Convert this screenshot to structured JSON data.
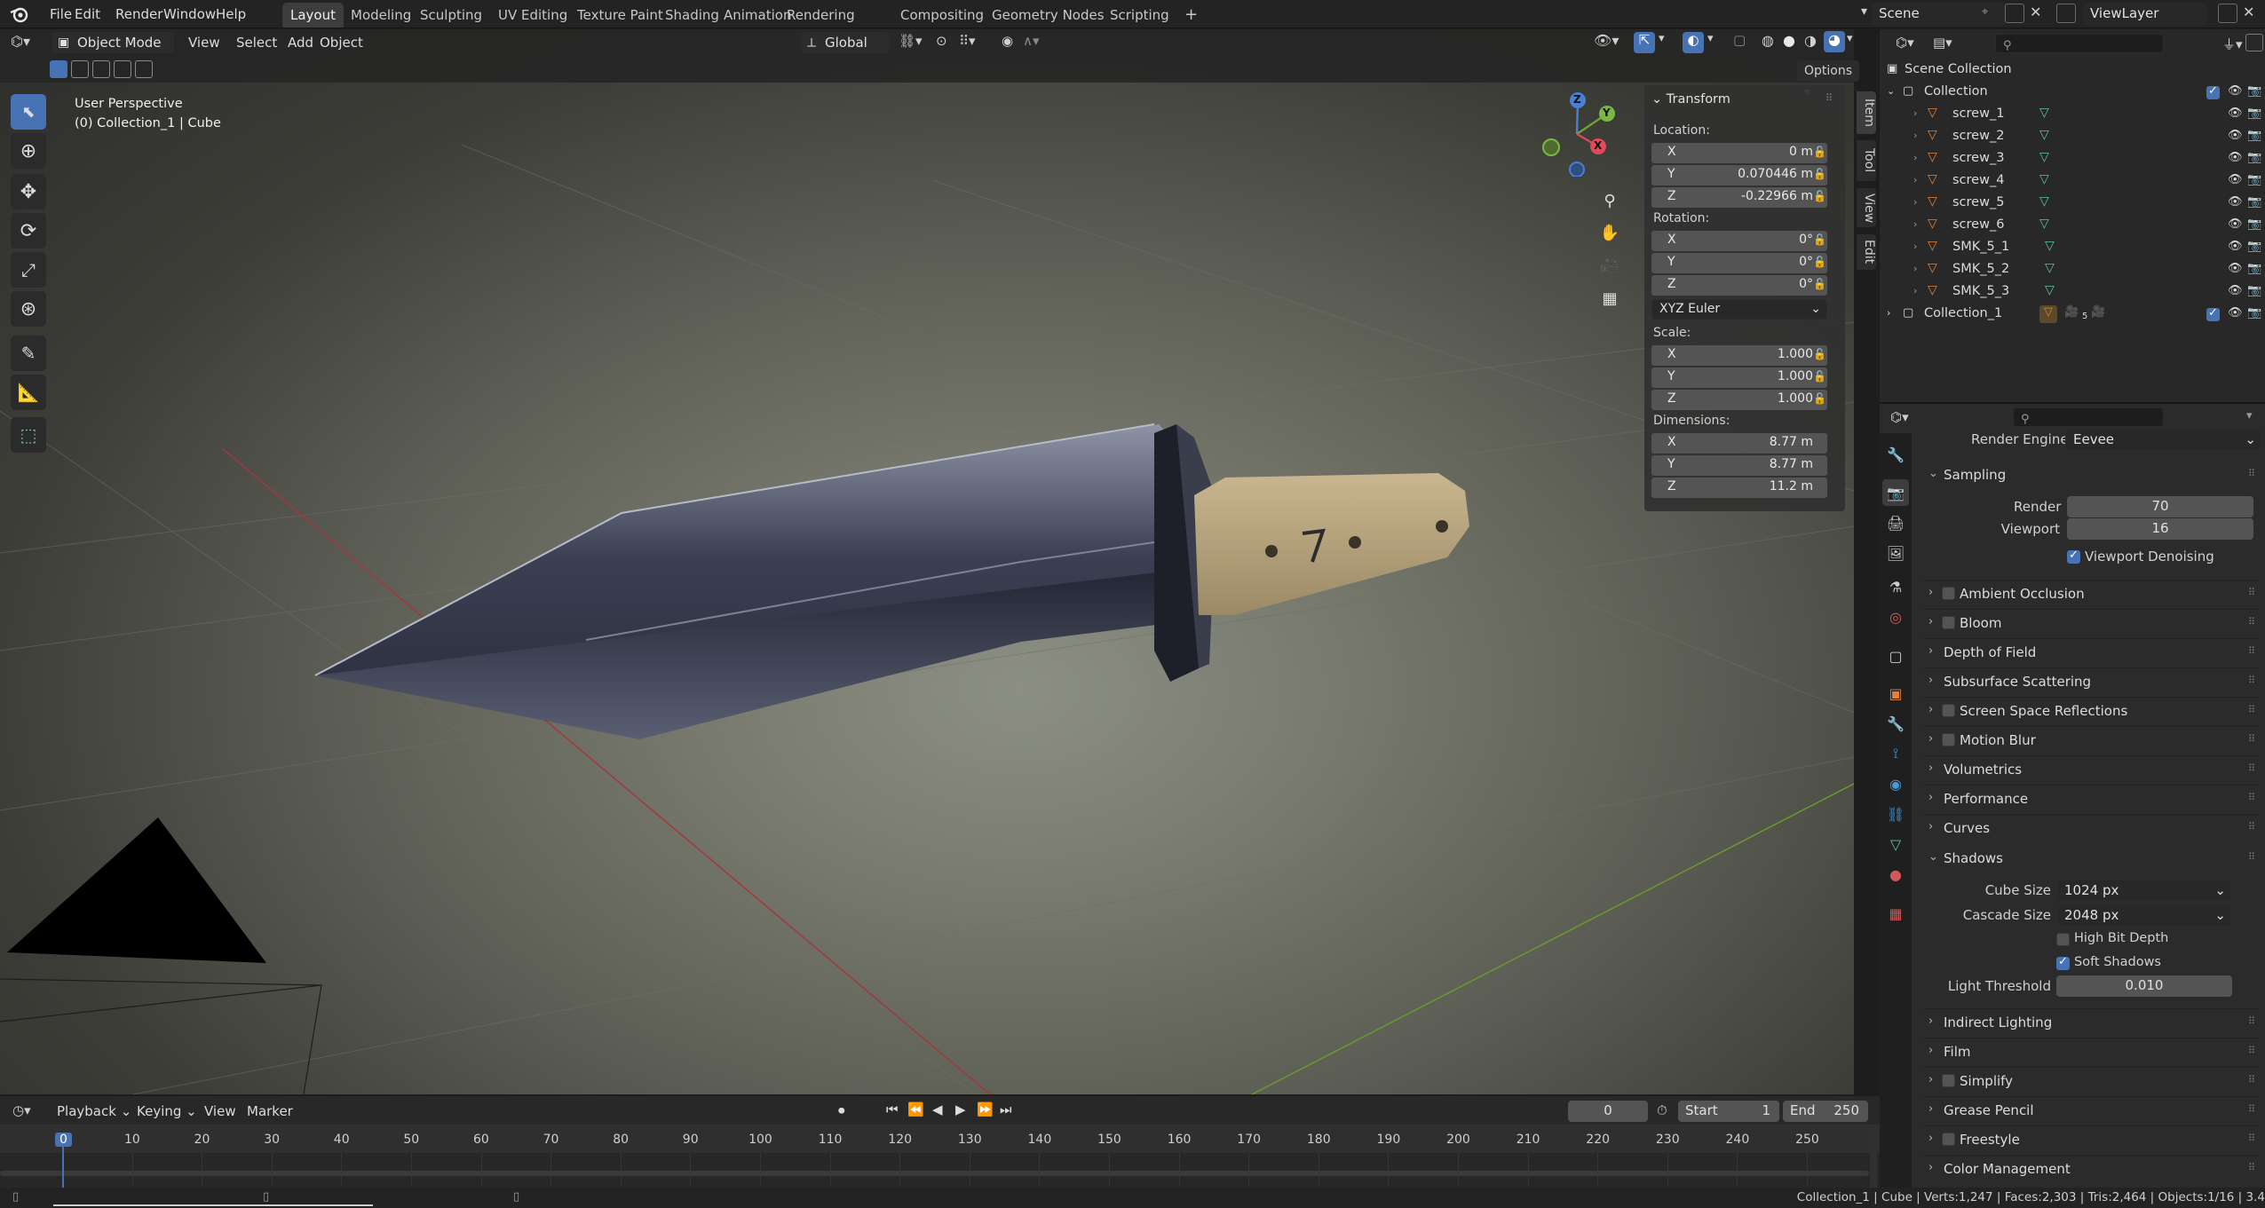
{
  "menus": [
    "File",
    "Edit",
    "Render",
    "Window",
    "Help"
  ],
  "workspaces": [
    "Layout",
    "Modeling",
    "Sculpting",
    "UV Editing",
    "Texture Paint",
    "Shading",
    "Animation",
    "Rendering",
    "Compositing",
    "Geometry Nodes",
    "Scripting"
  ],
  "active_workspace": "Layout",
  "add_tab": "+",
  "scene": "Scene",
  "view_layer": "ViewLayer",
  "viewport": {
    "mode": "Object Mode",
    "menus": [
      "View",
      "Select",
      "Add",
      "Object"
    ],
    "orientation": "Global",
    "options": "Options",
    "overlay_line1": "User Perspective",
    "overlay_line2": "(0) Collection_1 | Cube",
    "gizmo": {
      "x": "X",
      "y": "Y",
      "z": "Z"
    }
  },
  "npanel": {
    "header": "Transform",
    "location_label": "Location:",
    "location": [
      [
        "X",
        "0 m"
      ],
      [
        "Y",
        "0.070446 m"
      ],
      [
        "Z",
        "-0.22966 m"
      ]
    ],
    "rotation_label": "Rotation:",
    "rotation": [
      [
        "X",
        "0°"
      ],
      [
        "Y",
        "0°"
      ],
      [
        "Z",
        "0°"
      ]
    ],
    "rotation_mode": "XYZ Euler",
    "scale_label": "Scale:",
    "scale": [
      [
        "X",
        "1.000"
      ],
      [
        "Y",
        "1.000"
      ],
      [
        "Z",
        "1.000"
      ]
    ],
    "dimensions_label": "Dimensions:",
    "dimensions": [
      [
        "X",
        "8.77 m"
      ],
      [
        "Y",
        "8.77 m"
      ],
      [
        "Z",
        "11.2 m"
      ]
    ],
    "tabs": [
      "Item",
      "Tool",
      "View",
      "Edit"
    ]
  },
  "outliner": {
    "root": "Scene Collection",
    "collection": "Collection",
    "children": [
      "screw_1",
      "screw_2",
      "screw_3",
      "screw_4",
      "screw_5",
      "screw_6",
      "SMK_5_1",
      "SMK_5_2",
      "SMK_5_3"
    ],
    "collection_1": "Collection_1",
    "collection_1_badge": "5"
  },
  "properties": {
    "render_engine_label": "Render Engine",
    "render_engine": "Eevee",
    "sampling": {
      "header": "Sampling",
      "render_label": "Render",
      "render": "70",
      "viewport_label": "Viewport",
      "viewport": "16",
      "denoise": "Viewport Denoising"
    },
    "sections_a": [
      {
        "label": "Ambient Occlusion",
        "checkbox": true
      },
      {
        "label": "Bloom",
        "checkbox": true
      },
      {
        "label": "Depth of Field",
        "checkbox": false
      },
      {
        "label": "Subsurface Scattering",
        "checkbox": false
      },
      {
        "label": "Screen Space Reflections",
        "checkbox": true
      },
      {
        "label": "Motion Blur",
        "checkbox": true
      },
      {
        "label": "Volumetrics",
        "checkbox": false
      },
      {
        "label": "Performance",
        "checkbox": false
      },
      {
        "label": "Curves",
        "checkbox": false
      }
    ],
    "shadows": {
      "header": "Shadows",
      "cube_label": "Cube Size",
      "cube": "1024 px",
      "cascade_label": "Cascade Size",
      "cascade": "2048 px",
      "high_bit": "High Bit Depth",
      "soft": "Soft Shadows",
      "threshold_label": "Light Threshold",
      "threshold": "0.010"
    },
    "sections_b": [
      {
        "label": "Indirect Lighting",
        "checkbox": false
      },
      {
        "label": "Film",
        "checkbox": false
      },
      {
        "label": "Simplify",
        "checkbox": true
      },
      {
        "label": "Grease Pencil",
        "checkbox": false
      },
      {
        "label": "Freestyle",
        "checkbox": true
      },
      {
        "label": "Color Management",
        "checkbox": false
      }
    ]
  },
  "timeline": {
    "menus": [
      "Playback",
      "Keying",
      "View",
      "Marker"
    ],
    "current_frame": "0",
    "start_label": "Start",
    "start": "1",
    "end_label": "End",
    "end": "250",
    "ticks": [
      "0",
      "10",
      "20",
      "30",
      "40",
      "50",
      "60",
      "70",
      "80",
      "90",
      "100",
      "110",
      "120",
      "130",
      "140",
      "150",
      "160",
      "170",
      "180",
      "190",
      "200",
      "210",
      "220",
      "230",
      "240",
      "250"
    ]
  },
  "status": "Collection_1 | Cube | Verts:1,247 | Faces:2,303 | Tris:2,464 | Objects:1/16 | 3.4"
}
